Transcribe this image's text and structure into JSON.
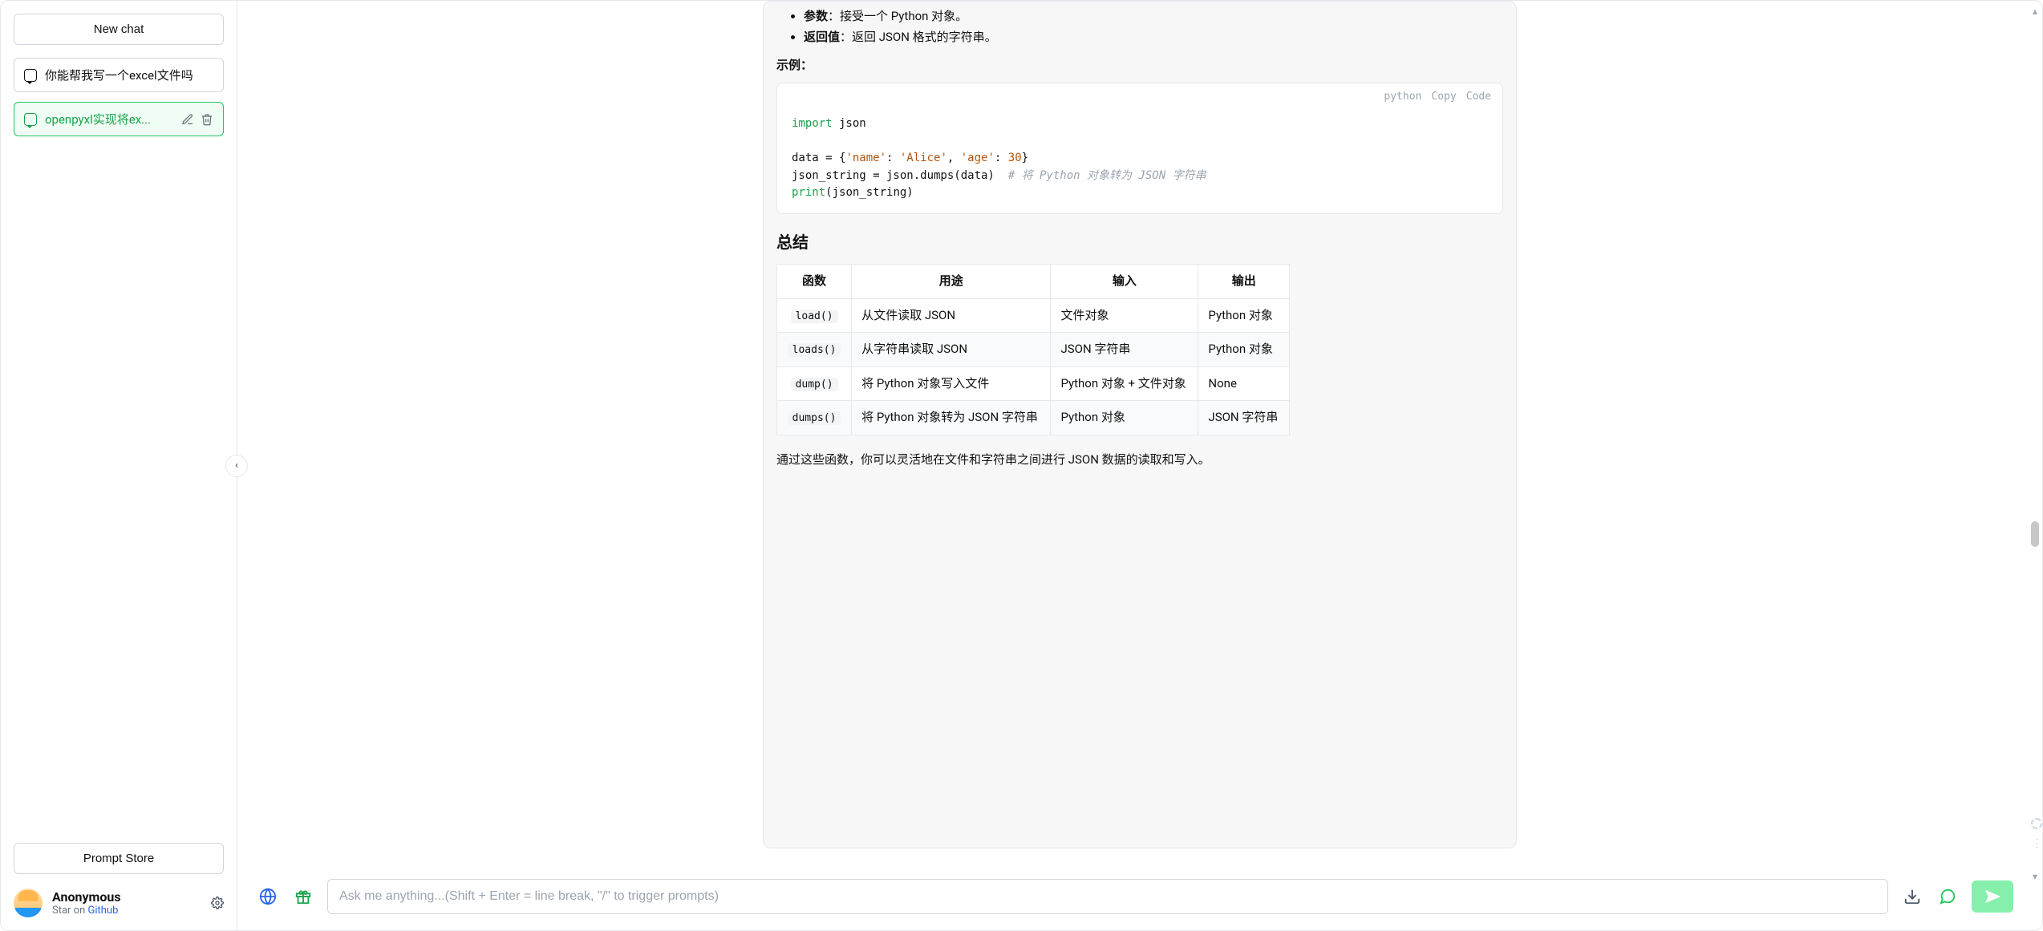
{
  "sidebar": {
    "new_chat_label": "New chat",
    "chats": [
      {
        "title": "你能帮我写一个excel文件吗"
      },
      {
        "title": "openpyxl实现将ex..."
      }
    ],
    "prompt_store_label": "Prompt Store",
    "user": {
      "name": "Anonymous",
      "star_prefix": "Star on ",
      "star_link": "Github"
    },
    "collapse_glyph": "‹"
  },
  "conversation": {
    "params_label": "参数",
    "params_text": "：接受一个 Python 对象。",
    "return_label": "返回值",
    "return_text": "：返回 JSON 格式的字符串。",
    "example_label": "示例：",
    "code": {
      "lang": "python",
      "copy": "Copy",
      "code_label": "Code",
      "tok_import": "import",
      "tok_json": " json",
      "line_data_prefix": "data = {",
      "str_name_k": "'name'",
      "sep1": ": ",
      "str_name_v": "'Alice'",
      "sep2": ", ",
      "str_age_k": "'age'",
      "sep3": ": ",
      "num_age": "30",
      "line_data_suffix": "}",
      "line_assign": "json_string = json.dumps(data)  ",
      "cmt_assign": "# 将 Python 对象转为 JSON 字符串",
      "tok_print": "print",
      "print_arg": "(json_string)"
    },
    "summary_heading": "总结",
    "table": {
      "headers": [
        "函数",
        "用途",
        "输入",
        "输出"
      ],
      "rows": [
        {
          "fn": "load()",
          "use": "从文件读取 JSON",
          "in": "文件对象",
          "out": "Python 对象"
        },
        {
          "fn": "loads()",
          "use": "从字符串读取 JSON",
          "in": "JSON 字符串",
          "out": "Python 对象"
        },
        {
          "fn": "dump()",
          "use": "将 Python 对象写入文件",
          "in": "Python 对象 + 文件对象",
          "out": "None"
        },
        {
          "fn": "dumps()",
          "use": "将 Python 对象转为 JSON 字符串",
          "in": "Python 对象",
          "out": "JSON 字符串"
        }
      ]
    },
    "closing_text": "通过这些函数，你可以灵活地在文件和字符串之间进行 JSON 数据的读取和写入。"
  },
  "composer": {
    "placeholder": "Ask me anything...(Shift + Enter = line break, \"/\" to trigger prompts)"
  }
}
